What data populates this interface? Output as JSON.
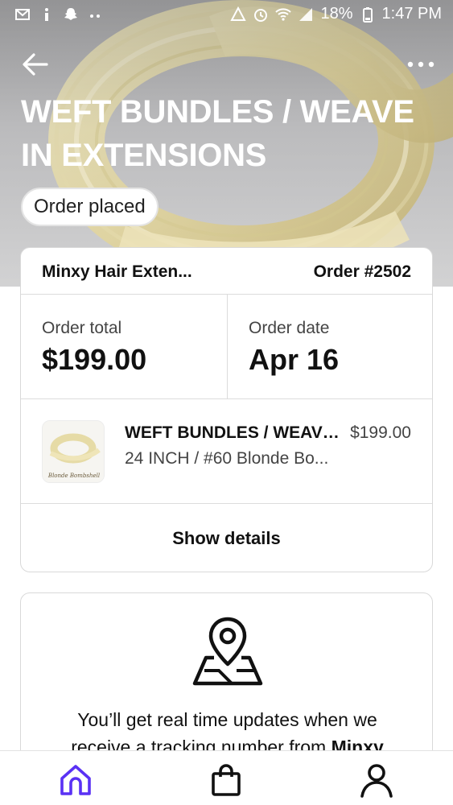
{
  "status_bar": {
    "battery": "18%",
    "time": "1:47 PM",
    "left_icons": [
      "gmail-icon",
      "info-icon",
      "snapchat-icon",
      "more-notifications-icon"
    ],
    "right_icons": [
      "data-saver-icon",
      "alarm-icon",
      "wifi-icon",
      "signal-icon",
      "battery-icon"
    ]
  },
  "header": {
    "title": "WEFT BUNDLES / WEAVE IN EXTENSIONS",
    "status": "Order placed",
    "back_icon": "arrow-left-icon",
    "menu_icon": "more-horizontal-icon"
  },
  "order": {
    "shop_name": "Minxy Hair Exten...",
    "order_number": "Order #2502",
    "total_label": "Order total",
    "total_value": "$199.00",
    "date_label": "Order date",
    "date_value": "Apr 16",
    "item": {
      "title": "WEFT BUNDLES / WEAVE ...",
      "price": "$199.00",
      "variant": "24 INCH / #60 Blonde Bo...",
      "thumb_caption": "Blonde Bombshell"
    },
    "show_details": "Show details"
  },
  "tracking": {
    "icon": "map-pin-icon",
    "message_prefix": "You’ll get real time updates when we receive a tracking number from",
    "message_shop": "Minxy"
  },
  "nav": {
    "items": [
      "home-icon",
      "shopping-bag-icon",
      "profile-icon"
    ],
    "active_color": "#5a31f4"
  }
}
